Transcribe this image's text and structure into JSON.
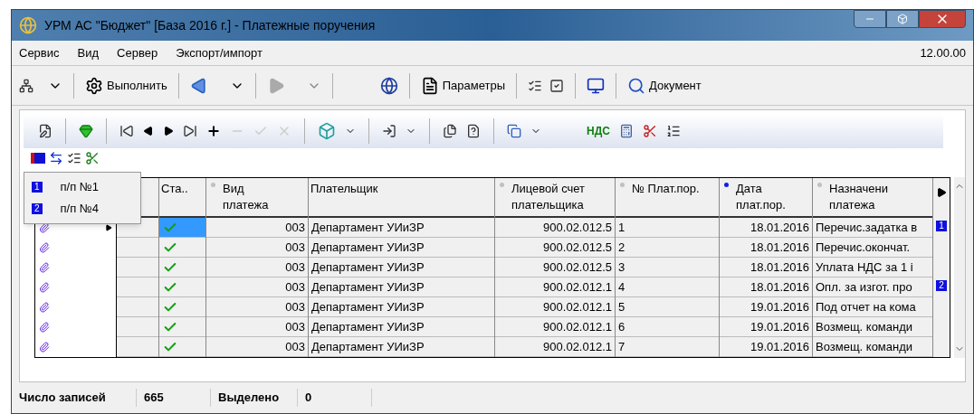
{
  "window": {
    "title": "УРМ АС \"Бюджет\" [База 2016 г.] - Платежные поручения"
  },
  "menu": {
    "items": [
      "Сервис",
      "Вид",
      "Сервер",
      "Экспорт/импорт"
    ],
    "version": "12.00.00"
  },
  "toolbar": {
    "run": "Выполнить",
    "params": "Параметры",
    "document": "Документ"
  },
  "toolbar2": {
    "vat": "НДС"
  },
  "bookmark_menu": [
    {
      "badge": "1",
      "label": "п/п №1"
    },
    {
      "badge": "2",
      "label": "п/п №4"
    }
  ],
  "table": {
    "columns": [
      {
        "label": "Ста.."
      },
      {
        "label": "Вид платежа",
        "sorted": false
      },
      {
        "label": "Плательщик"
      },
      {
        "label": "Лицевой счет плательщика",
        "sorted": false
      },
      {
        "label": "№ Плат.пор.",
        "sorted": false
      },
      {
        "label": "Дата плат.пор.",
        "sorted": true
      },
      {
        "label": "Назначени платежа",
        "sorted": false
      }
    ],
    "rows": [
      {
        "current": true,
        "checked": true,
        "type": "003",
        "payer": "Департамент УИиЗР",
        "account": "900.02.012.5",
        "number": "1",
        "date": "18.01.2016",
        "purpose": "Перечис.задатка в",
        "bookmark": "1"
      },
      {
        "current": false,
        "checked": true,
        "type": "003",
        "payer": "Департамент УИиЗР",
        "account": "900.02.012.5",
        "number": "2",
        "date": "18.01.2016",
        "purpose": "Перечис.окончат."
      },
      {
        "current": false,
        "checked": true,
        "type": "003",
        "payer": "Департамент УИиЗР",
        "account": "900.02.012.5",
        "number": "3",
        "date": "18.01.2016",
        "purpose": "Уплата НДС за 1 і"
      },
      {
        "current": false,
        "checked": true,
        "type": "003",
        "payer": "Департамент УИиЗР",
        "account": "900.02.012.1",
        "number": "4",
        "date": "18.01.2016",
        "purpose": "Опл. за изгот. про",
        "bookmark": "2"
      },
      {
        "current": false,
        "checked": true,
        "type": "003",
        "payer": "Департамент УИиЗР",
        "account": "900.02.012.1",
        "number": "5",
        "date": "19.01.2016",
        "purpose": "Под отчет на кома"
      },
      {
        "current": false,
        "checked": true,
        "type": "003",
        "payer": "Департамент УИиЗР",
        "account": "900.02.012.1",
        "number": "6",
        "date": "19.01.2016",
        "purpose": "Возмещ. команди"
      },
      {
        "current": false,
        "checked": true,
        "type": "003",
        "payer": "Департамент УИиЗР",
        "account": "900.02.012.1",
        "number": "7",
        "date": "19.01.2016",
        "purpose": "Возмещ. команди"
      }
    ]
  },
  "status_bar": {
    "count_label": "Число записей",
    "count": "665",
    "selected_label": "Выделено",
    "selected": "0"
  }
}
